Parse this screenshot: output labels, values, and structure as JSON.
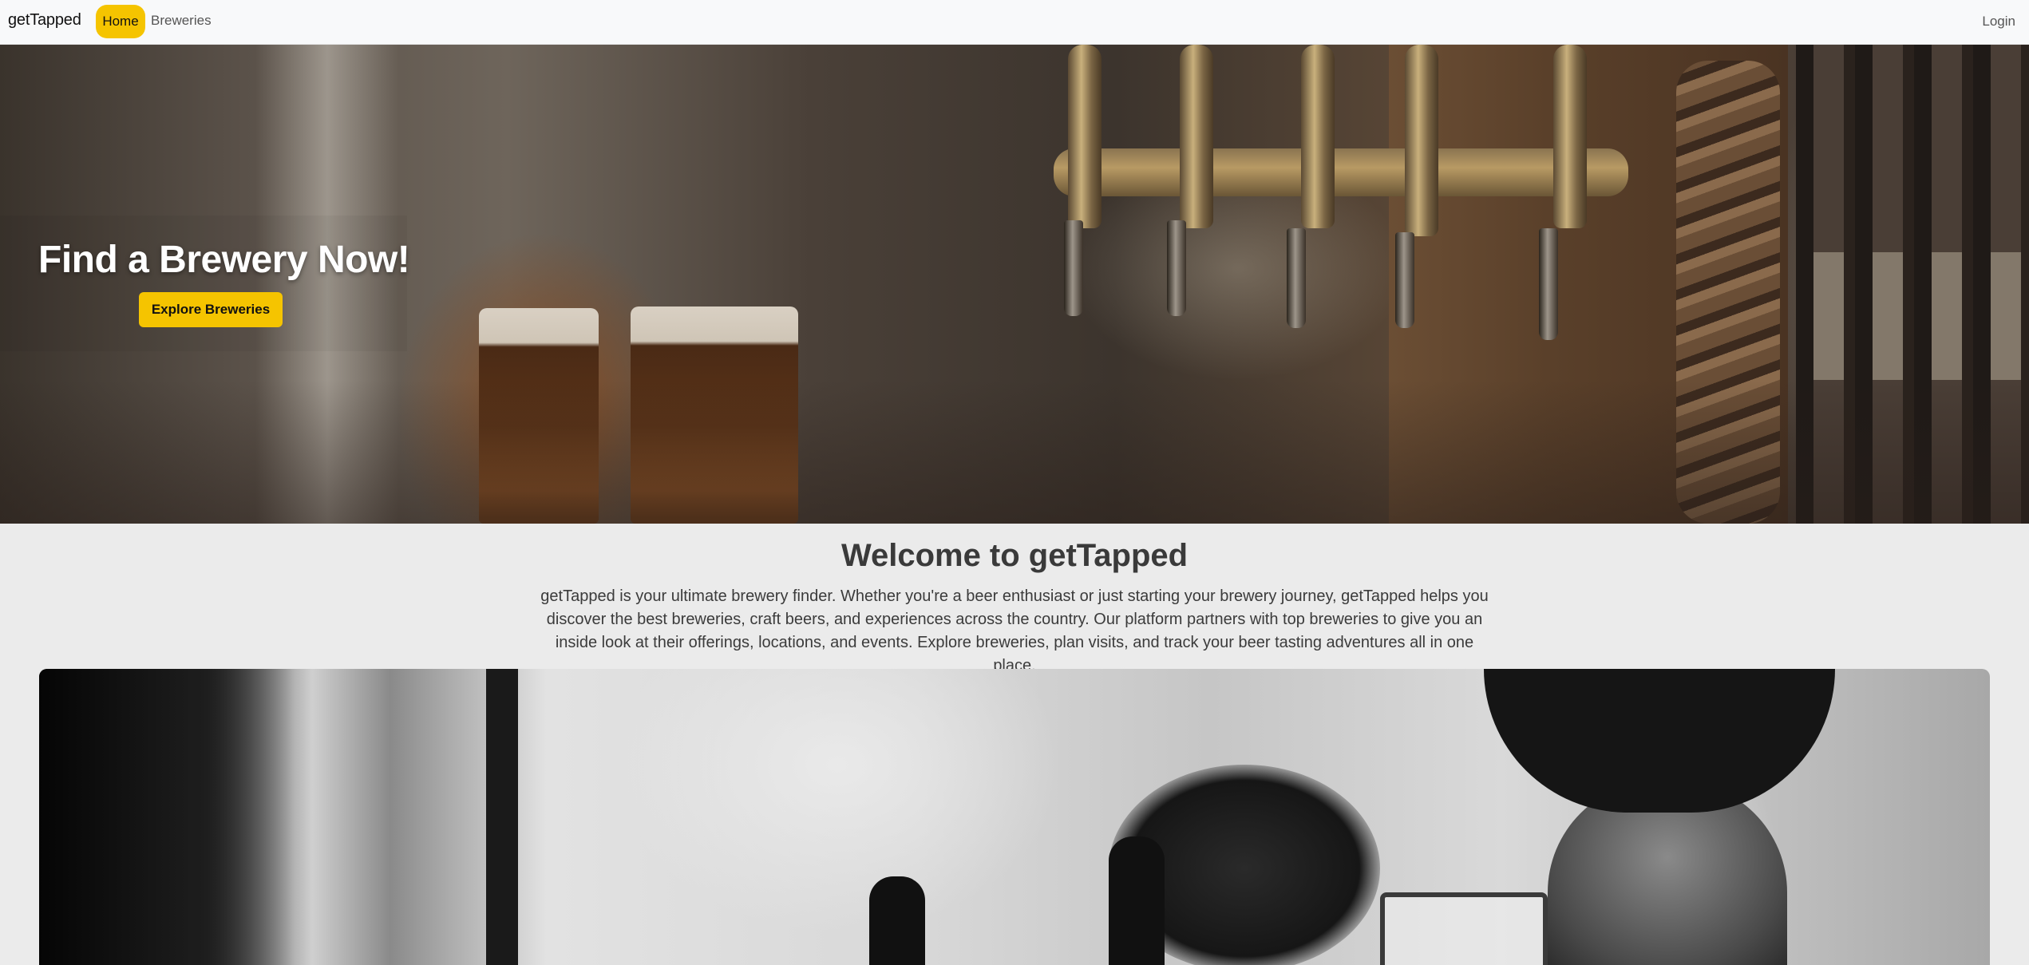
{
  "navbar": {
    "brand": "getTapped",
    "links": [
      {
        "label": "Home",
        "active": true
      },
      {
        "label": "Breweries",
        "active": false
      }
    ],
    "login_label": "Login",
    "accent_color": "#f5c400"
  },
  "hero": {
    "title": "Find a Brewery Now!",
    "cta_label": "Explore Breweries"
  },
  "welcome": {
    "title": "Welcome to getTapped",
    "description": "getTapped is your ultimate brewery finder. Whether you're a beer enthusiast or just starting your brewery journey, getTapped helps you discover the best breweries, craft beers, and experiences across the country. Our platform partners with top breweries to give you an inside look at their offerings, locations, and events. Explore breweries, plan visits, and track your beer tasting adventures all in one place."
  }
}
